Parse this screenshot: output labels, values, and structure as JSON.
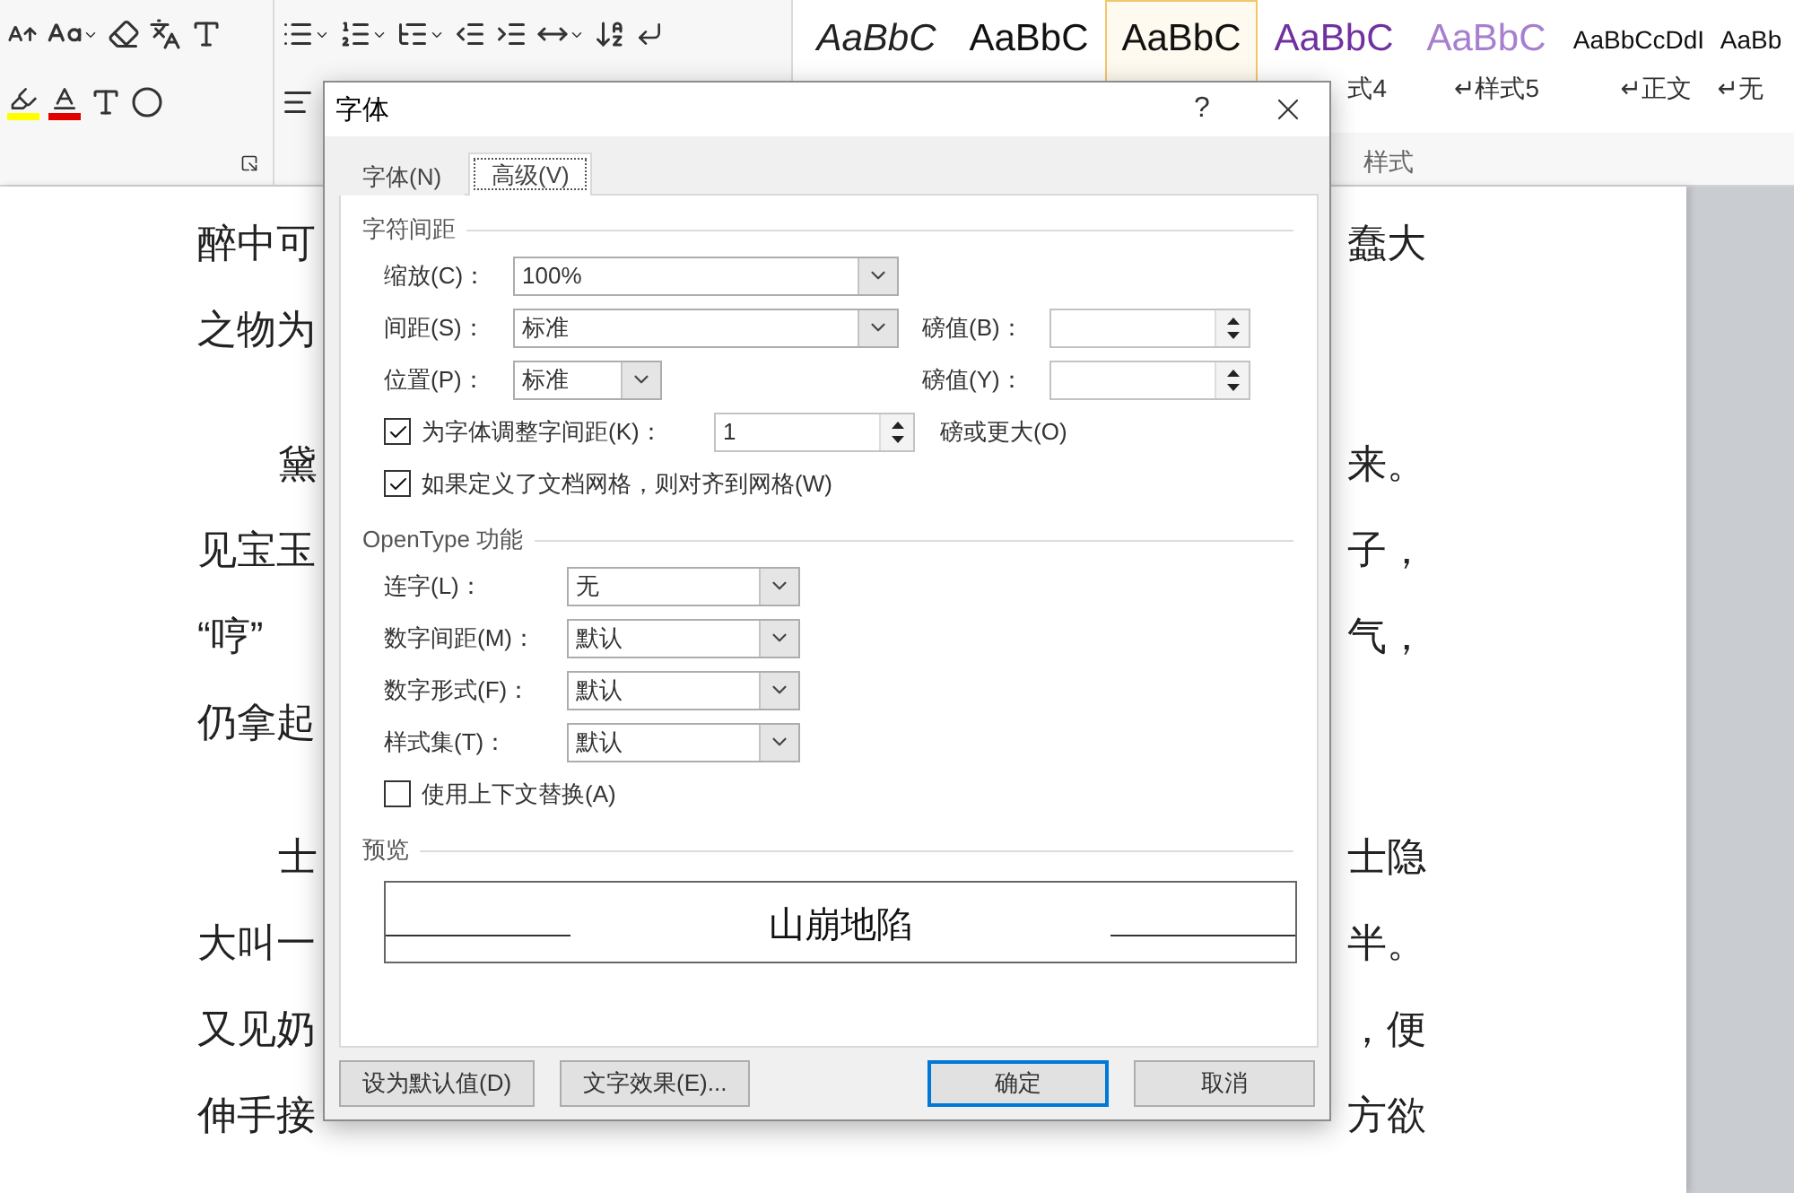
{
  "ribbon": {
    "gallery": [
      {
        "sample": "AaBbC",
        "italic": true,
        "small": false,
        "color": "#222222",
        "selected": false
      },
      {
        "sample": "AaBbC",
        "italic": false,
        "small": false,
        "color": "#111111",
        "selected": false
      },
      {
        "sample": "AaBbC",
        "italic": false,
        "small": false,
        "color": "#111111",
        "selected": true
      },
      {
        "sample": "AaBbC",
        "italic": false,
        "small": false,
        "color": "#7030a0",
        "selected": false,
        "label": "式4"
      },
      {
        "sample": "AaBbC",
        "italic": false,
        "small": false,
        "color": "#a67fcf",
        "selected": false,
        "label": "↵样式5"
      },
      {
        "sample": "AaBbCcDdI",
        "italic": false,
        "small": true,
        "color": "#111111",
        "selected": false,
        "label": "↵正文"
      },
      {
        "sample": "AaBb",
        "italic": false,
        "small": true,
        "color": "#111111",
        "selected": false,
        "label": "↵无"
      }
    ],
    "styles_group_label": "样式"
  },
  "document": {
    "paragraphs": [
      {
        "indent": false,
        "lines": [
          {
            "left": "醉中可",
            "right": "蠢大"
          },
          {
            "left": "之物为"
          }
        ]
      },
      {
        "indent": true,
        "lines": [
          {
            "left": "黛",
            "right": "来。"
          },
          {
            "left": "见宝玉",
            "right": "子，"
          },
          {
            "left": "“哼”",
            "right": "气，"
          },
          {
            "left": "仍拿起"
          }
        ]
      },
      {
        "indent": true,
        "lines": [
          {
            "left": "士",
            "right": "士隐"
          },
          {
            "left": "大叫一",
            "right": "半。"
          },
          {
            "left": "又见奶",
            "right": "，便"
          },
          {
            "left": "伸手接",
            "right": "方欲"
          }
        ]
      }
    ]
  },
  "dialog": {
    "title": "字体",
    "help": "?",
    "tabs": [
      {
        "label": "字体(N)",
        "selected": false
      },
      {
        "label": "高级(V)",
        "selected": true
      }
    ],
    "sections": [
      {
        "title": "字符间距",
        "rows": [
          {
            "kind": "wide_dropdown",
            "label": "缩放(C)：",
            "value": "100%"
          },
          {
            "kind": "wide_dropdown",
            "label": "间距(S)：",
            "value": "标准",
            "side_label": "磅值(B)："
          },
          {
            "kind": "short_dropdown",
            "label": "位置(P)：",
            "value": "标准",
            "side_label": "磅值(Y)："
          },
          {
            "kind": "check_spinner",
            "label": "为字体调整字间距(K)：",
            "checked": true,
            "value": "1",
            "suffix": "磅或更大(O)"
          },
          {
            "kind": "check",
            "label": "如果定义了文档网格，则对齐到网格(W)",
            "checked": true
          }
        ]
      },
      {
        "title": "OpenType 功能",
        "rows": [
          {
            "kind": "medium_dropdown",
            "label": "连字(L)：",
            "value": "无"
          },
          {
            "kind": "medium_dropdown",
            "label": "数字间距(M)：",
            "value": "默认"
          },
          {
            "kind": "medium_dropdown",
            "label": "数字形式(F)：",
            "value": "默认"
          },
          {
            "kind": "medium_dropdown",
            "label": "样式集(T)：",
            "value": "默认"
          },
          {
            "kind": "check",
            "label": "使用上下文替换(A)",
            "checked": false
          }
        ]
      }
    ],
    "preview": {
      "title": "预览",
      "text": "山崩地陷"
    },
    "left_buttons": [
      {
        "label": "设为默认值(D)",
        "default": false
      },
      {
        "label": "文字效果(E)...",
        "default": false
      }
    ],
    "right_buttons": [
      {
        "label": "确定",
        "default": true
      },
      {
        "label": "取消",
        "default": false
      }
    ]
  }
}
